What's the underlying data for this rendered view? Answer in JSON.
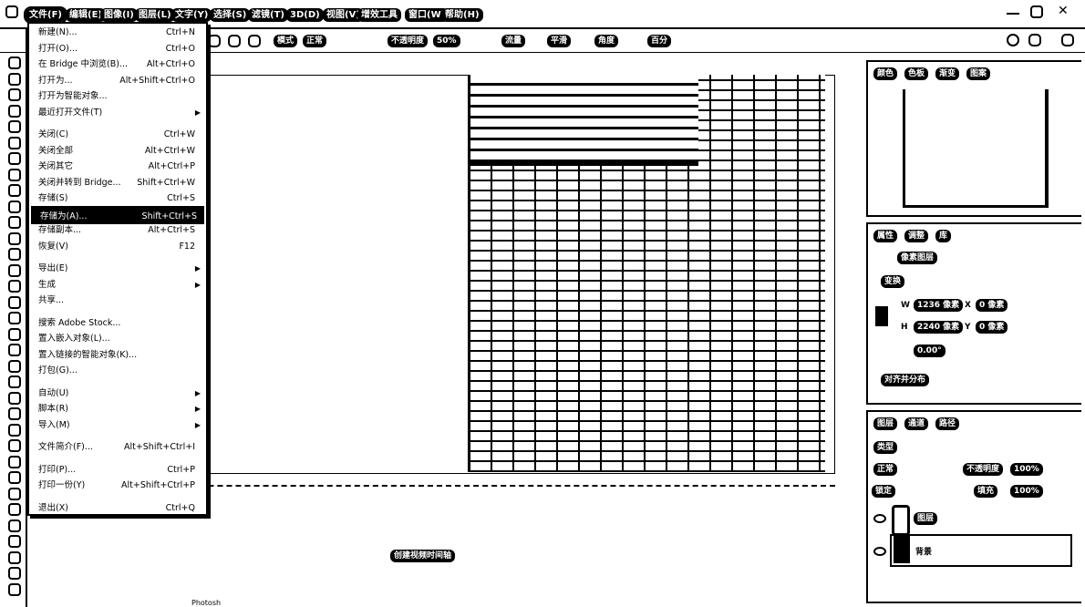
{
  "menubar": {
    "items": [
      "文件(F)",
      "编辑(E)",
      "图像(I)",
      "图层(L)",
      "文字(Y)",
      "选择(S)",
      "滤镜(T)",
      "3D(D)",
      "视图(V)",
      "增效工具",
      "窗口(W)",
      "帮助(H)"
    ]
  },
  "options": {
    "mode_label": "模式",
    "mode_value": "正常",
    "opacity_label": "不透明度",
    "opacity_value": "50%",
    "flow_label": "流量",
    "smooth_label": "平滑",
    "angle_label": "角度",
    "smooth_value": "百分"
  },
  "file_menu": {
    "items": [
      {
        "label": "新建(N)...",
        "shortcut": "Ctrl+N"
      },
      {
        "label": "打开(O)...",
        "shortcut": "Ctrl+O"
      },
      {
        "label": "在 Bridge 中浏览(B)...",
        "shortcut": "Alt+Ctrl+O"
      },
      {
        "label": "打开为...",
        "shortcut": "Alt+Shift+Ctrl+O"
      },
      {
        "label": "打开为智能对象...",
        "shortcut": ""
      },
      {
        "label": "最近打开文件(T)",
        "shortcut": "",
        "submenu": true
      },
      {
        "label": "关闭(C)",
        "shortcut": "Ctrl+W"
      },
      {
        "label": "关闭全部",
        "shortcut": "Alt+Ctrl+W"
      },
      {
        "label": "关闭其它",
        "shortcut": "Alt+Ctrl+P"
      },
      {
        "label": "关闭并转到 Bridge...",
        "shortcut": "Shift+Ctrl+W"
      },
      {
        "label": "存储(S)",
        "shortcut": "Ctrl+S"
      },
      {
        "label": "存储为(A)...",
        "shortcut": "Shift+Ctrl+S",
        "highlighted": true
      },
      {
        "label": "存储副本...",
        "shortcut": "Alt+Ctrl+S"
      },
      {
        "label": "恢复(V)",
        "shortcut": "F12"
      },
      {
        "label": "导出(E)",
        "shortcut": "",
        "submenu": true
      },
      {
        "label": "生成",
        "shortcut": "",
        "submenu": true
      },
      {
        "label": "共享...",
        "shortcut": ""
      },
      {
        "label": "搜索 Adobe Stock...",
        "shortcut": ""
      },
      {
        "label": "置入嵌入对象(L)...",
        "shortcut": ""
      },
      {
        "label": "置入链接的智能对象(K)...",
        "shortcut": ""
      },
      {
        "label": "打包(G)...",
        "shortcut": ""
      },
      {
        "label": "自动(U)",
        "shortcut": "",
        "submenu": true
      },
      {
        "label": "脚本(R)",
        "shortcut": "",
        "submenu": true
      },
      {
        "label": "导入(M)",
        "shortcut": "",
        "submenu": true
      },
      {
        "label": "文件简介(F)...",
        "shortcut": "Alt+Shift+Ctrl+I"
      },
      {
        "label": "打印(P)...",
        "shortcut": "Ctrl+P"
      },
      {
        "label": "打印一份(Y)",
        "shortcut": "Alt+Shift+Ctrl+P"
      },
      {
        "label": "退出(X)",
        "shortcut": "Ctrl+Q"
      }
    ]
  },
  "top_panel": {
    "tabs": [
      "颜色",
      "色板",
      "渐变",
      "图案"
    ]
  },
  "properties": {
    "tabs": [
      "属性",
      "调整",
      "库"
    ],
    "layer_type": "像素图层",
    "section": "变换",
    "w_label": "W",
    "w_value": "1236 像素",
    "x_label": "X",
    "x_value": "0 像素",
    "h_label": "H",
    "h_value": "2240 像素",
    "y_label": "Y",
    "y_value": "0 像素",
    "angle_value": "0.00°",
    "align_label": "对齐并分布"
  },
  "layers": {
    "tabs": [
      "图层",
      "通道",
      "路径"
    ],
    "filter_label": "类型",
    "blend_mode": "正常",
    "opacity_label": "不透明度",
    "opacity_value": "100%",
    "lock_label": "锁定",
    "fill_label": "填充",
    "fill_value": "100%",
    "items": [
      {
        "name": "图层"
      },
      {
        "name": "背景"
      }
    ]
  },
  "timeline": {
    "create_button": "创建视频时间轴"
  },
  "status": {
    "text": "Photosh"
  }
}
